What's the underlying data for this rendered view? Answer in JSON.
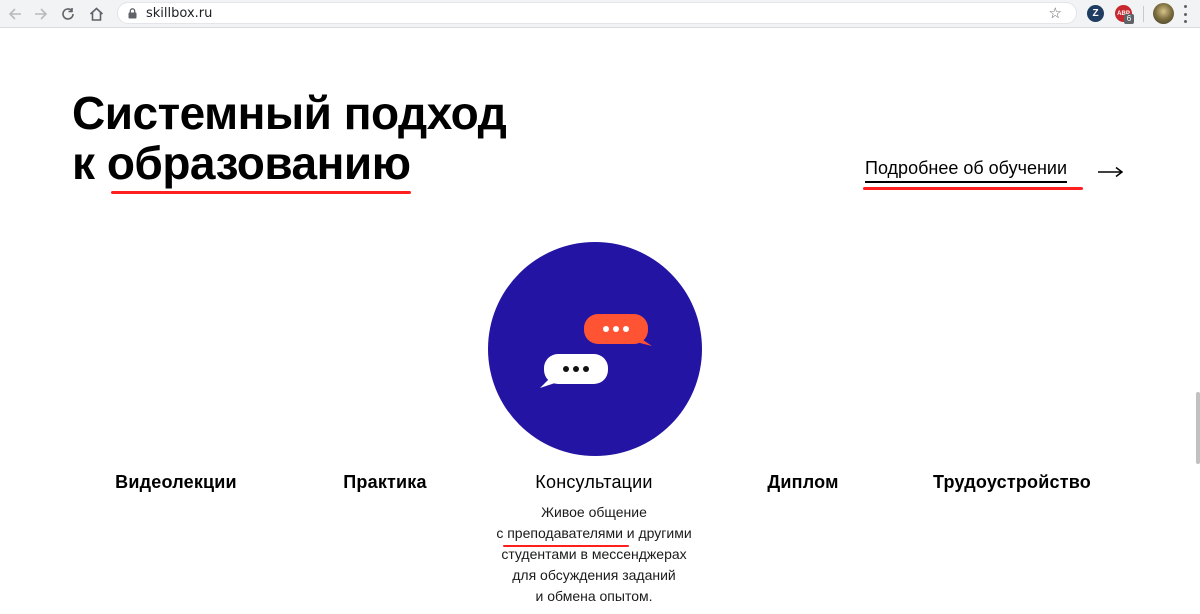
{
  "browser": {
    "url": "skillbox.ru",
    "icons": {
      "back": "arrow-left-icon",
      "forward": "arrow-right-icon",
      "reload": "reload-icon",
      "home": "home-icon",
      "lock": "lock-icon",
      "star": "star-icon",
      "menu": "kebab-menu-icon"
    },
    "extensions": {
      "z_label": "Z",
      "abp_label": "ABP",
      "abp_badge": "6"
    }
  },
  "page": {
    "headline_line1": "Системный подход",
    "headline_line2_prefix": "к ",
    "headline_line2_highlight": "образованию",
    "more_link": "Подробнее об обучении",
    "features": [
      {
        "label": "Видеолекции"
      },
      {
        "label": "Практика"
      },
      {
        "label": "Консультации"
      },
      {
        "label": "Диплом"
      },
      {
        "label": "Трудоустройство"
      }
    ],
    "description": {
      "line1": "Живое общение",
      "line2_prefix": "с ",
      "line2_highlight": "преподавателями",
      "line2_suffix": " и другими",
      "line3": "студентами в мессенджерах",
      "line4": "для обсуждения заданий",
      "line5": "и обмена опытом."
    },
    "illustration": {
      "icon": "chat-bubbles-icon",
      "circle_color": "#2314a3",
      "bubble_orange": "#ff5434",
      "bubble_white": "#ffffff"
    },
    "accent_color": "#ff1f1f"
  }
}
